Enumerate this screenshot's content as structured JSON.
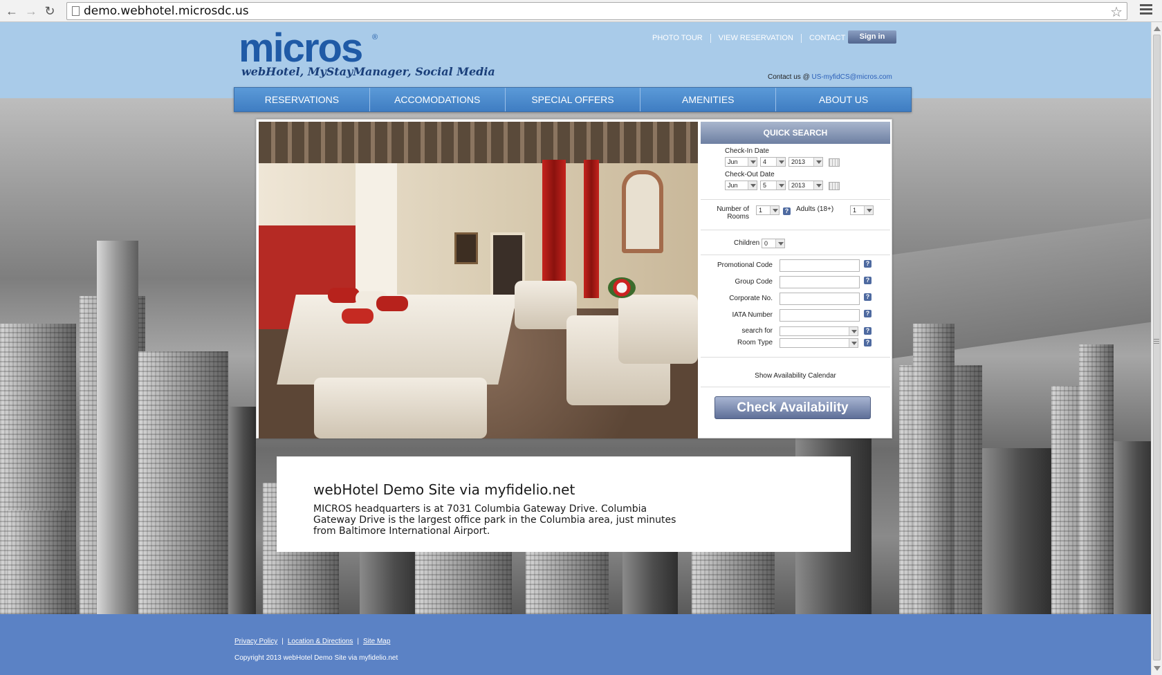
{
  "browser": {
    "url": "demo.webhotel.microsdc.us"
  },
  "header": {
    "logo_word": "micros",
    "logo_reg": "®",
    "tagline": "webHotel, MyStayManager, Social Media",
    "top_links": [
      "PHOTO TOUR",
      "VIEW RESERVATION",
      "CONTACT US"
    ],
    "signin_label": "Sign in",
    "contact_prefix": "Contact us @",
    "contact_email": "US-myfidCS@micros.com"
  },
  "nav": {
    "items": [
      "RESERVATIONS",
      "ACCOMODATIONS",
      "SPECIAL OFFERS",
      "AMENITIES",
      "ABOUT US"
    ]
  },
  "quick_search": {
    "title": "QUICK SEARCH",
    "checkin_label": "Check-In Date",
    "checkin": {
      "month": "Jun",
      "day": "4",
      "year": "2013"
    },
    "checkout_label": "Check-Out Date",
    "checkout": {
      "month": "Jun",
      "day": "5",
      "year": "2013"
    },
    "rooms_label_1": "Number of",
    "rooms_label_2": "Rooms",
    "rooms_value": "1",
    "adults_label": "Adults (18+)",
    "adults_value": "1",
    "children_label": "Children",
    "children_value": "0",
    "promo_label": "Promotional Code",
    "group_label": "Group Code",
    "corporate_label": "Corporate No.",
    "iata_label": "IATA Number",
    "search_for_label": "search for",
    "room_type_label": "Room Type",
    "help_glyph": "?",
    "show_calendar": "Show Availability Calendar",
    "check_button": "Check Availability"
  },
  "intro": {
    "title": "webHotel Demo Site via myfidelio.net",
    "text": "MICROS headquarters is at 7031 Columbia Gateway Drive. Columbia Gateway Drive is the largest office park in the Columbia area, just minutes from Baltimore International Airport."
  },
  "footer": {
    "links": [
      "Privacy Policy",
      "Location & Directions",
      "Site Map"
    ],
    "separator": "|",
    "copyright": "Copyright 2013  webHotel Demo Site via myfidelio.net"
  },
  "colors": {
    "header_band": "#a9cbe9",
    "nav": "#4b87cc",
    "footer": "#5b82c5",
    "logo": "#1f5aa6"
  }
}
